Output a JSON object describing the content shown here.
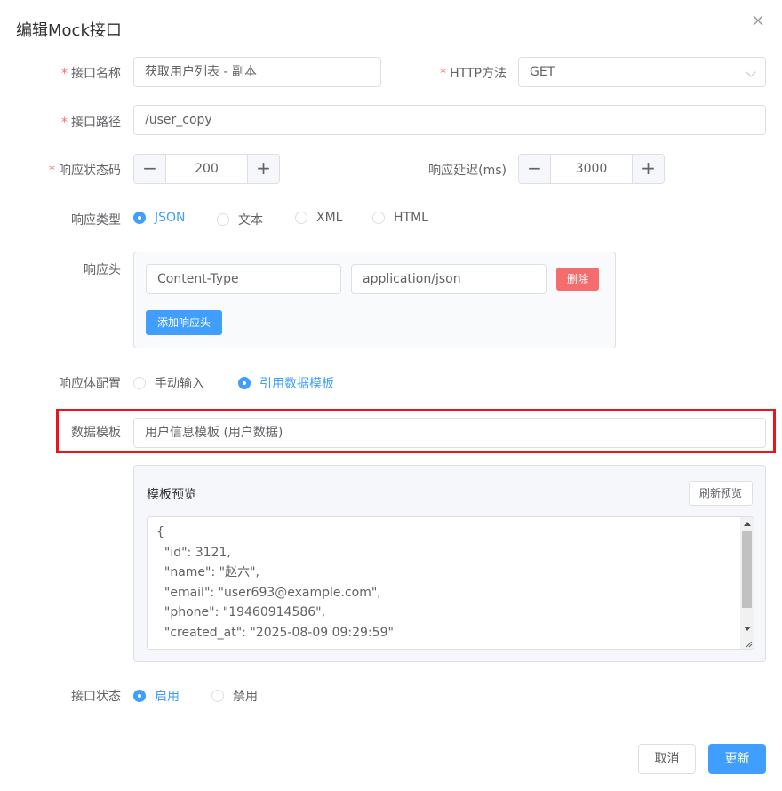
{
  "dialog": {
    "title": "编辑Mock接口"
  },
  "form": {
    "name": {
      "label": "接口名称",
      "value": "获取用户列表 - 副本"
    },
    "method": {
      "label": "HTTP方法",
      "value": "GET"
    },
    "path": {
      "label": "接口路径",
      "value": "/user_copy"
    },
    "status_code": {
      "label": "响应状态码",
      "value": "200"
    },
    "delay": {
      "label": "响应延迟(ms)",
      "value": "3000"
    },
    "response_type": {
      "label": "响应类型",
      "options": [
        "JSON",
        "文本",
        "XML",
        "HTML"
      ],
      "selected": "JSON"
    },
    "headers": {
      "label": "响应头",
      "items": [
        {
          "key": "Content-Type",
          "value": "application/json"
        }
      ],
      "delete_label": "删除",
      "add_label": "添加响应头"
    },
    "body_config": {
      "label": "响应体配置",
      "options": [
        "手动输入",
        "引用数据模板"
      ],
      "selected": "引用数据模板"
    },
    "template": {
      "label": "数据模板",
      "value": "用户信息模板 (用户数据)"
    },
    "preview": {
      "title": "模板预览",
      "refresh_label": "刷新预览",
      "code": "{\n  \"id\": 3121,\n  \"name\": \"赵六\",\n  \"email\": \"user693@example.com\",\n  \"phone\": \"19460914586\",\n  \"created_at\": \"2025-08-09 09:29:59\""
    },
    "status": {
      "label": "接口状态",
      "options": [
        "启用",
        "禁用"
      ],
      "selected": "启用"
    }
  },
  "footer": {
    "cancel_label": "取消",
    "submit_label": "更新"
  },
  "colors": {
    "primary": "#409eff",
    "danger": "#f56c6c",
    "required": "#f56c6c",
    "highlight": "#e8161a"
  }
}
